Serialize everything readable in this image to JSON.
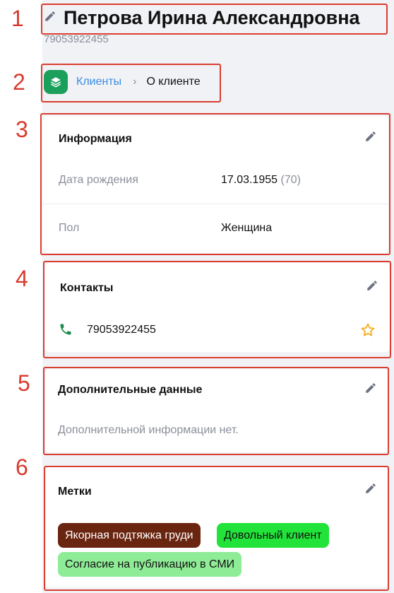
{
  "markers": [
    "1",
    "2",
    "3",
    "4",
    "5",
    "6"
  ],
  "header": {
    "name": "Петрова Ирина Александровна",
    "phone": "79053922455"
  },
  "breadcrumb": {
    "link": "Клиенты",
    "separator": "›",
    "current": "О клиенте"
  },
  "info": {
    "title": "Информация",
    "rows": [
      {
        "label": "Дата рождения",
        "value": "17.03.1955",
        "extra": "(70)"
      },
      {
        "label": "Пол",
        "value": "Женщина"
      }
    ]
  },
  "contacts": {
    "title": "Контакты",
    "phone": "79053922455"
  },
  "extra": {
    "title": "Дополнительные данные",
    "empty_text": "Дополнительной информации нет."
  },
  "tags": {
    "title": "Метки",
    "items": [
      {
        "label": "Якорная подтяжка груди",
        "bg": "#6a2510",
        "fg": "#ffffff"
      },
      {
        "label": "Довольный клиент",
        "bg": "#22e33a",
        "fg": "#111111"
      },
      {
        "label": "Согласие на публикацию в СМИ",
        "bg": "#8fec96",
        "fg": "#111111"
      }
    ]
  },
  "colors": {
    "accent_link": "#3b8de0",
    "brand_green": "#1aa05a",
    "phone_icon": "#1e8a4c",
    "star": "#f2b01e",
    "annotation_red": "#db3d31"
  }
}
